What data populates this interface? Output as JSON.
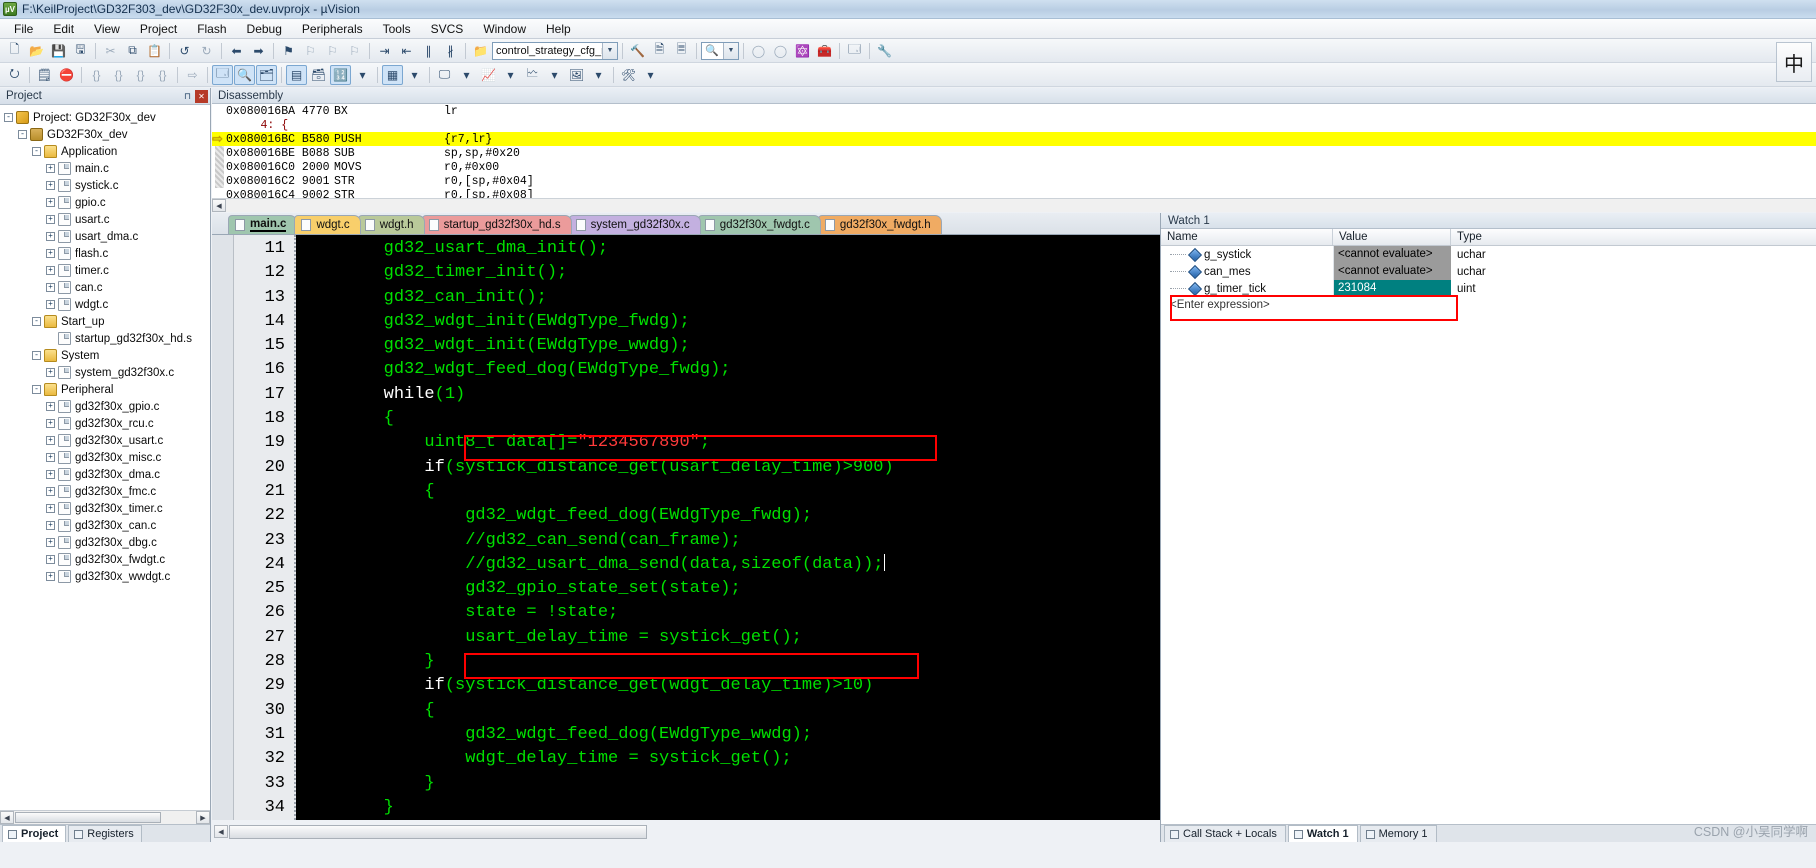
{
  "window": {
    "title": "F:\\KeilProject\\GD32F303_dev\\GD32F30x_dev.uvprojx - µVision",
    "logo_text": "µV"
  },
  "menu": [
    "File",
    "Edit",
    "View",
    "Project",
    "Flash",
    "Debug",
    "Peripherals",
    "Tools",
    "SVCS",
    "Window",
    "Help"
  ],
  "toolbar1": {
    "icons": [
      "new-file-icon",
      "open-file-icon",
      "save-icon",
      "save-all-icon",
      "cut-icon",
      "copy-icon",
      "paste-icon",
      "undo-icon",
      "redo-icon",
      "back-icon",
      "forward-icon",
      "bookmark-icon",
      "bookmark-next-icon",
      "bookmark-prev-icon",
      "bookmark-clear-icon",
      "indent-icon",
      "outdent-icon",
      "comment-icon",
      "uncomment-icon",
      "open-folder-icon"
    ],
    "target_combo": "control_strategy_cfg_m_",
    "after_icons": [
      "build-icon",
      "rebuild-icon",
      "batch-build-icon",
      "search-icon",
      "zoom-dropdown-icon",
      "circle-a-icon",
      "circle-b-icon",
      "target-options-icon",
      "manage-icon",
      "window-icon",
      "config-icon"
    ]
  },
  "toolbar2": {
    "icons": [
      "reset-icon",
      "step-icon",
      "stop-debug-icon",
      "brace1-icon",
      "brace2-icon",
      "brace3-icon",
      "brace4-icon",
      "step-into-icon",
      "step-over-icon",
      "step-out-icon",
      "run-to-cursor-icon",
      "run-icon",
      "command-window-icon",
      "disassembly-icon",
      "symbols-icon",
      "registers-icon",
      "call-stack-icon",
      "watch-window-icon",
      "memory-window-icon",
      "serial-window-icon",
      "analysis-icon",
      "trace-icon",
      "system-viewer-icon",
      "toolbox-icon"
    ],
    "ime_label": "中"
  },
  "project_pane": {
    "title": "Project",
    "buttons": [
      "pin-icon",
      "close-icon"
    ],
    "tree": [
      {
        "label": "Project: GD32F30x_dev",
        "indent": 0,
        "expander": "-",
        "icon": "proj",
        "name": "tree-project-root"
      },
      {
        "label": "GD32F30x_dev",
        "indent": 1,
        "expander": "-",
        "icon": "tgt",
        "name": "tree-target"
      },
      {
        "label": "Application",
        "indent": 2,
        "expander": "-",
        "icon": "fold",
        "name": "tree-group-application"
      },
      {
        "label": "main.c",
        "indent": 3,
        "expander": "+",
        "icon": "file",
        "name": "tree-file-main-c"
      },
      {
        "label": "systick.c",
        "indent": 3,
        "expander": "+",
        "icon": "file",
        "name": "tree-file-systick-c"
      },
      {
        "label": "gpio.c",
        "indent": 3,
        "expander": "+",
        "icon": "file",
        "name": "tree-file-gpio-c"
      },
      {
        "label": "usart.c",
        "indent": 3,
        "expander": "+",
        "icon": "file",
        "name": "tree-file-usart-c"
      },
      {
        "label": "usart_dma.c",
        "indent": 3,
        "expander": "+",
        "icon": "file",
        "name": "tree-file-usart-dma-c"
      },
      {
        "label": "flash.c",
        "indent": 3,
        "expander": "+",
        "icon": "file",
        "name": "tree-file-flash-c"
      },
      {
        "label": "timer.c",
        "indent": 3,
        "expander": "+",
        "icon": "file",
        "name": "tree-file-timer-c"
      },
      {
        "label": "can.c",
        "indent": 3,
        "expander": "+",
        "icon": "file",
        "name": "tree-file-can-c"
      },
      {
        "label": "wdgt.c",
        "indent": 3,
        "expander": "+",
        "icon": "file",
        "name": "tree-file-wdgt-c"
      },
      {
        "label": "Start_up",
        "indent": 2,
        "expander": "-",
        "icon": "fold",
        "name": "tree-group-startup"
      },
      {
        "label": "startup_gd32f30x_hd.s",
        "indent": 3,
        "expander": "",
        "icon": "file",
        "name": "tree-file-startup-s"
      },
      {
        "label": "System",
        "indent": 2,
        "expander": "-",
        "icon": "fold",
        "name": "tree-group-system"
      },
      {
        "label": "system_gd32f30x.c",
        "indent": 3,
        "expander": "+",
        "icon": "file",
        "name": "tree-file-system-c"
      },
      {
        "label": "Peripheral",
        "indent": 2,
        "expander": "-",
        "icon": "fold",
        "name": "tree-group-peripheral"
      },
      {
        "label": "gd32f30x_gpio.c",
        "indent": 3,
        "expander": "+",
        "icon": "file",
        "name": "tree-file-p-gpio"
      },
      {
        "label": "gd32f30x_rcu.c",
        "indent": 3,
        "expander": "+",
        "icon": "file",
        "name": "tree-file-p-rcu"
      },
      {
        "label": "gd32f30x_usart.c",
        "indent": 3,
        "expander": "+",
        "icon": "file",
        "name": "tree-file-p-usart"
      },
      {
        "label": "gd32f30x_misc.c",
        "indent": 3,
        "expander": "+",
        "icon": "file",
        "name": "tree-file-p-misc"
      },
      {
        "label": "gd32f30x_dma.c",
        "indent": 3,
        "expander": "+",
        "icon": "file",
        "name": "tree-file-p-dma"
      },
      {
        "label": "gd32f30x_fmc.c",
        "indent": 3,
        "expander": "+",
        "icon": "file",
        "name": "tree-file-p-fmc"
      },
      {
        "label": "gd32f30x_timer.c",
        "indent": 3,
        "expander": "+",
        "icon": "file",
        "name": "tree-file-p-timer"
      },
      {
        "label": "gd32f30x_can.c",
        "indent": 3,
        "expander": "+",
        "icon": "file",
        "name": "tree-file-p-can"
      },
      {
        "label": "gd32f30x_dbg.c",
        "indent": 3,
        "expander": "+",
        "icon": "file",
        "name": "tree-file-p-dbg"
      },
      {
        "label": "gd32f30x_fwdgt.c",
        "indent": 3,
        "expander": "+",
        "icon": "file",
        "name": "tree-file-p-fwdgt"
      },
      {
        "label": "gd32f30x_wwdgt.c",
        "indent": 3,
        "expander": "+",
        "icon": "file",
        "name": "tree-file-p-wwdgt"
      }
    ],
    "tabs": [
      {
        "label": "Project",
        "selected": true
      },
      {
        "label": "Registers",
        "selected": false
      }
    ]
  },
  "disassembly": {
    "title": "Disassembly",
    "lines": [
      {
        "addr": "0x080016BA",
        "code": "4770",
        "mnem": "BX",
        "ops": "lr",
        "highlight": false,
        "source": false,
        "arrow": false
      },
      {
        "addr": "",
        "code": "",
        "mnem": "",
        "ops": "",
        "highlight": false,
        "source": true,
        "arrow": false,
        "text": "     4: {"
      },
      {
        "addr": "0x080016BC",
        "code": "B580",
        "mnem": "PUSH",
        "ops": "{r7,lr}",
        "highlight": true,
        "source": false,
        "arrow": true
      },
      {
        "addr": "0x080016BE",
        "code": "B088",
        "mnem": "SUB",
        "ops": "sp,sp,#0x20",
        "highlight": false,
        "source": false,
        "arrow": false
      },
      {
        "addr": "0x080016C0",
        "code": "2000",
        "mnem": "MOVS",
        "ops": "r0,#0x00",
        "highlight": false,
        "source": false,
        "arrow": false
      },
      {
        "addr": "0x080016C2",
        "code": "9001",
        "mnem": "STR",
        "ops": "r0,[sp,#0x04]",
        "highlight": false,
        "source": false,
        "arrow": false
      },
      {
        "addr": "0x080016C4",
        "code": "9002",
        "mnem": "STR",
        "ops": "r0,[sp,#0x08]",
        "highlight": false,
        "source": false,
        "arrow": false
      }
    ]
  },
  "editor": {
    "tabs": [
      {
        "label": "main.c",
        "color": "#9fc6ae",
        "selected": true
      },
      {
        "label": "wdgt.c",
        "color": "#f8cf6b",
        "selected": false
      },
      {
        "label": "wdgt.h",
        "color": "#b9c99a",
        "selected": false
      },
      {
        "label": "startup_gd32f30x_hd.s",
        "color": "#eb9b9b",
        "selected": false
      },
      {
        "label": "system_gd32f30x.c",
        "color": "#c3b0e0",
        "selected": false
      },
      {
        "label": "gd32f30x_fwdgt.c",
        "color": "#9fc6ae",
        "selected": false
      },
      {
        "label": "gd32f30x_fwdgt.h",
        "color": "#f0ab63",
        "selected": false
      }
    ],
    "tab_controls": [
      "chevron-down-icon",
      "close-icon"
    ],
    "first_line_number": 11,
    "lines": [
      {
        "n": 11,
        "indent": 8,
        "text": "gd32_usart_dma_init();"
      },
      {
        "n": 12,
        "indent": 8,
        "text": "gd32_timer_init();"
      },
      {
        "n": 13,
        "indent": 8,
        "text": "gd32_can_init();"
      },
      {
        "n": 14,
        "indent": 8,
        "text": "gd32_wdgt_init(EWdgType_fwdg);"
      },
      {
        "n": 15,
        "indent": 8,
        "text": "gd32_wdgt_init(EWdgType_wwdg);"
      },
      {
        "n": 16,
        "indent": 8,
        "text": "gd32_wdgt_feed_dog(EWdgType_fwdg);"
      },
      {
        "n": 17,
        "indent": 8,
        "text": "while(1)",
        "kw": "while"
      },
      {
        "n": 18,
        "indent": 8,
        "text": "{"
      },
      {
        "n": 19,
        "indent": 12,
        "text": "uint8_t data[]=\"1234567890\";",
        "str": "\"1234567890\""
      },
      {
        "n": 20,
        "indent": 12,
        "text": "if(systick_distance_get(usart_delay_time)>900)",
        "kw": "if"
      },
      {
        "n": 21,
        "indent": 12,
        "text": "{"
      },
      {
        "n": 22,
        "indent": 16,
        "text": "gd32_wdgt_feed_dog(EWdgType_fwdg);"
      },
      {
        "n": 23,
        "indent": 16,
        "text": "//gd32_can_send(can_frame);"
      },
      {
        "n": 24,
        "indent": 16,
        "text": "//gd32_usart_dma_send(data,sizeof(data));"
      },
      {
        "n": 25,
        "indent": 16,
        "text": "gd32_gpio_state_set(state);"
      },
      {
        "n": 26,
        "indent": 16,
        "text": "state = !state;"
      },
      {
        "n": 27,
        "indent": 16,
        "text": "usart_delay_time = systick_get();"
      },
      {
        "n": 28,
        "indent": 12,
        "text": "}"
      },
      {
        "n": 29,
        "indent": 12,
        "text": "if(systick_distance_get(wdgt_delay_time)>10)",
        "kw": "if"
      },
      {
        "n": 30,
        "indent": 12,
        "text": "{"
      },
      {
        "n": 31,
        "indent": 16,
        "text": "gd32_wdgt_feed_dog(EWdgType_wwdg);"
      },
      {
        "n": 32,
        "indent": 16,
        "text": "wdgt_delay_time = systick_get();"
      },
      {
        "n": 33,
        "indent": 12,
        "text": "}"
      },
      {
        "n": 34,
        "indent": 8,
        "text": "}"
      }
    ],
    "annotations": [
      {
        "name": "highlight-box-line-20",
        "label": "systick_distance_get(usart_delay_time)>900"
      },
      {
        "name": "highlight-box-line-29",
        "label": "systick_distance_get(wdgt_delay_time)>10"
      }
    ]
  },
  "watch": {
    "title": "Watch 1",
    "columns": [
      "Name",
      "Value",
      "Type"
    ],
    "rows": [
      {
        "name": "g_systick",
        "value": "<cannot evaluate>",
        "type": "uchar",
        "value_style": "gray",
        "highlighted": false
      },
      {
        "name": "can_mes",
        "value": "<cannot evaluate>",
        "type": "uchar",
        "value_style": "gray",
        "highlighted": false
      },
      {
        "name": "g_timer_tick",
        "value": "231084",
        "type": "uint",
        "value_style": "sel",
        "highlighted": true
      }
    ],
    "enter_expression": "<Enter expression>",
    "tabs": [
      {
        "label": "Call Stack + Locals",
        "selected": false
      },
      {
        "label": "Watch 1",
        "selected": true
      },
      {
        "label": "Memory 1",
        "selected": false
      }
    ],
    "watermark": "CSDN @小吴同学啊"
  },
  "colors": {
    "highlight_yellow": "#ffff00",
    "annotation_red": "#ff0000",
    "code_green": "#00e000",
    "code_string_red": "#ff3b3b",
    "selection_teal": "#008080"
  }
}
